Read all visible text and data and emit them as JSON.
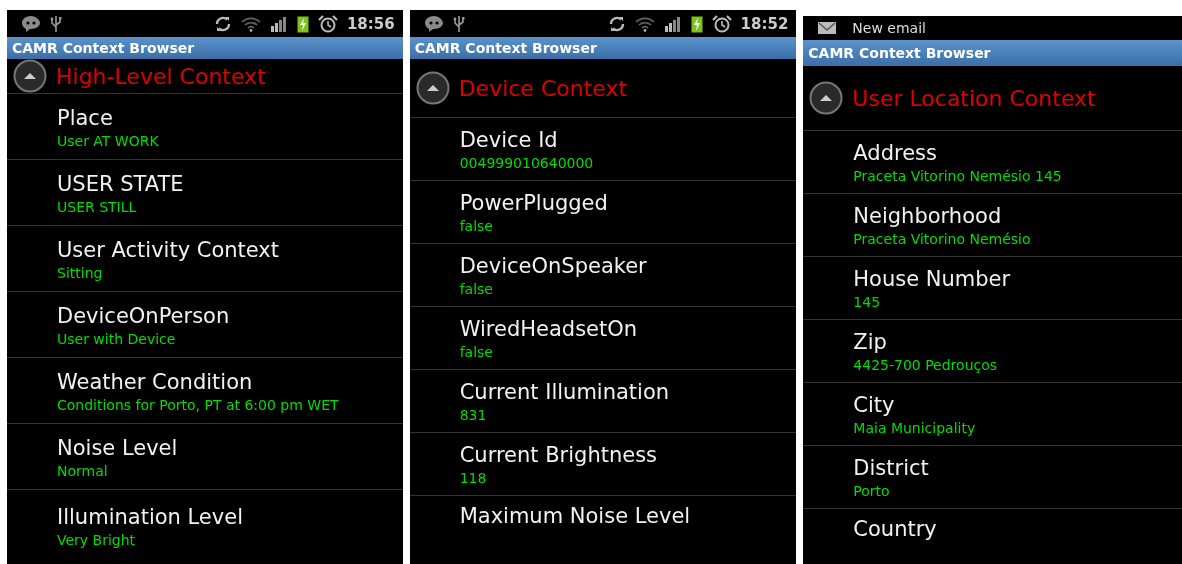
{
  "panels": [
    {
      "status_bar": {
        "kind": "icons",
        "time": "18:56"
      },
      "title": "CAMR Context Browser",
      "header": "High-Level Context",
      "items": [
        {
          "label": "Place",
          "value": "User AT WORK"
        },
        {
          "label": "USER STATE",
          "value": "USER STILL"
        },
        {
          "label": "User Activity Context",
          "value": "Sitting"
        },
        {
          "label": "DeviceOnPerson",
          "value": "User with Device"
        },
        {
          "label": "Weather Condition",
          "value": "Conditions for Porto, PT at 6:00 pm WET"
        },
        {
          "label": "Noise Level",
          "value": "Normal"
        },
        {
          "label": "Illumination Level",
          "value": "Very Bright"
        }
      ]
    },
    {
      "status_bar": {
        "kind": "icons",
        "time": "18:52"
      },
      "title": "CAMR Context Browser",
      "header": "Device Context",
      "items": [
        {
          "label": "Device Id",
          "value": "004999010640000"
        },
        {
          "label": "PowerPlugged",
          "value": "false"
        },
        {
          "label": "DeviceOnSpeaker",
          "value": "false"
        },
        {
          "label": "WiredHeadsetOn",
          "value": "false"
        },
        {
          "label": "Current Illumination",
          "value": "831"
        },
        {
          "label": "Current Brightness",
          "value": "118"
        },
        {
          "label": "Maximum Noise Level"
        }
      ]
    },
    {
      "status_bar": {
        "kind": "notification",
        "text": "New email"
      },
      "title": "CAMR Context Browser",
      "header": "User Location Context",
      "items": [
        {
          "label": "Address",
          "value": "Praceta Vitorino Nemésio 145"
        },
        {
          "label": "Neighborhood",
          "value": "Praceta Vitorino Nemésio"
        },
        {
          "label": "House Number",
          "value": "145"
        },
        {
          "label": "Zip",
          "value": "4425-700 Pedrouços"
        },
        {
          "label": "City",
          "value": "Maia Municipality"
        },
        {
          "label": "District",
          "value": "Porto"
        },
        {
          "label": "Country"
        }
      ]
    }
  ]
}
